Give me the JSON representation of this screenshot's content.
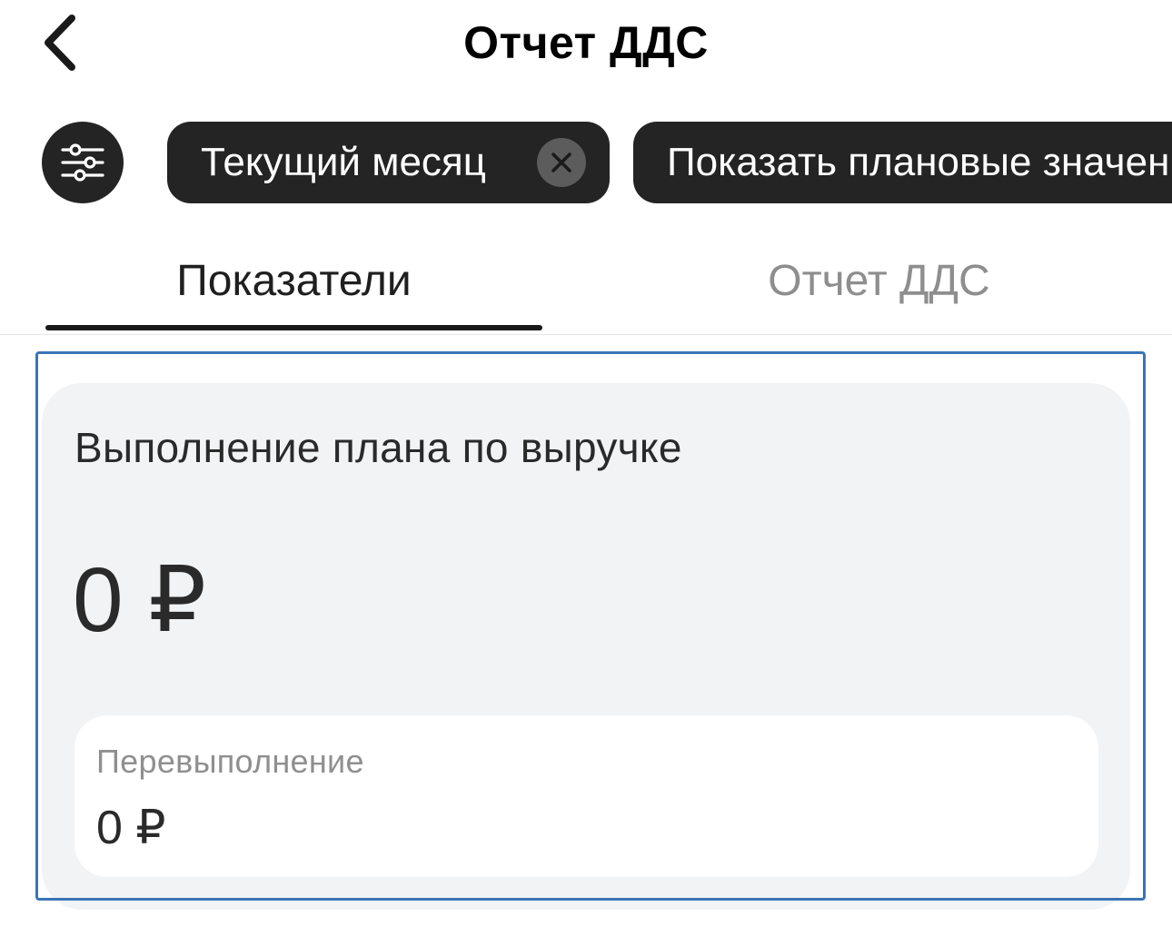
{
  "header": {
    "title": "Отчет ДДС",
    "back_icon": "chevron-left-icon"
  },
  "filters": {
    "settings_icon": "sliders-icon",
    "period_chip": "Текущий месяц",
    "period_clear_icon": "close-icon",
    "plan_chip": "Показать плановые значения"
  },
  "tabs": [
    {
      "label": "Показатели",
      "active": true
    },
    {
      "label": "Отчет ДДС",
      "active": false
    }
  ],
  "card": {
    "title": "Выполнение плана по выручке",
    "value": "0 ₽",
    "sub": {
      "label": "Перевыполнение",
      "value": "0 ₽"
    }
  },
  "colors": {
    "chip_bg": "#242424",
    "card_bg": "#f2f3f5",
    "highlight_outline": "#3b74b8",
    "inactive_tab": "#8e8e8e"
  }
}
